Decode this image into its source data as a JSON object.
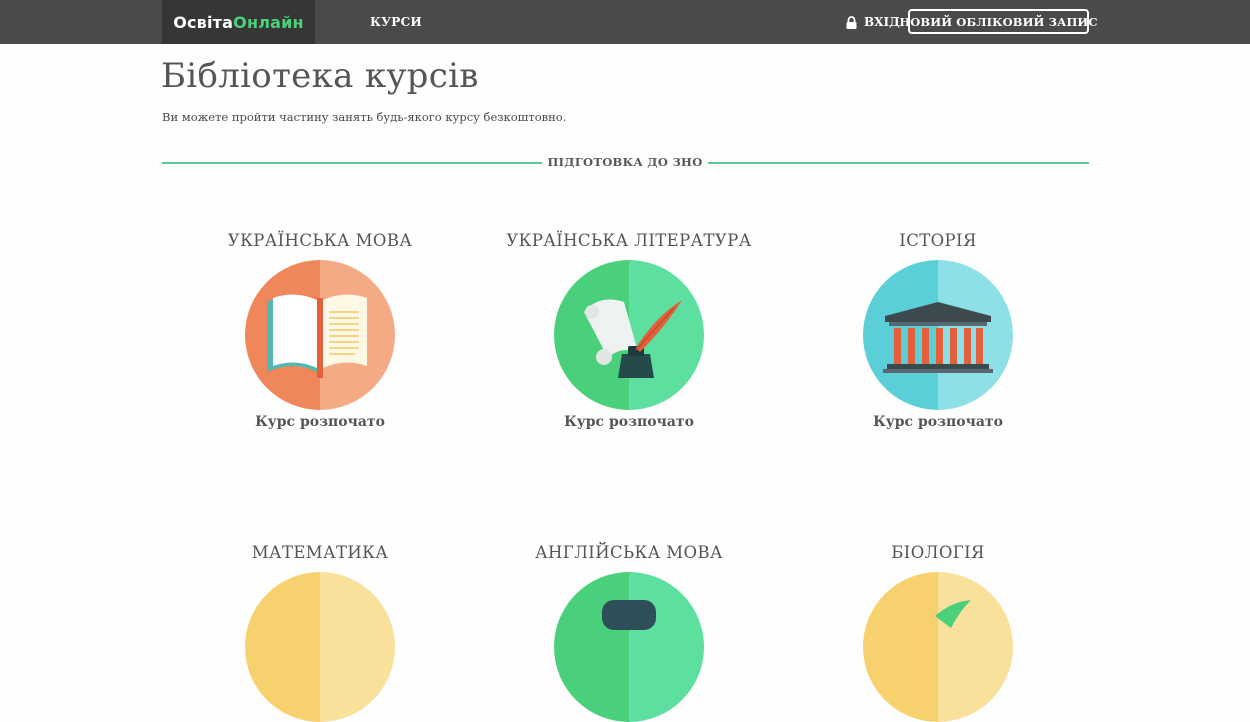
{
  "header": {
    "logo_part1": "Освіта",
    "logo_part2": "Онлайн",
    "nav_courses": "КУРСИ",
    "login": "ВХІД",
    "register": "НОВИЙ ОБЛІКОВИЙ ЗАПИС"
  },
  "page": {
    "title": "Бібліотека курсів",
    "subtitle": "Ви можете пройти частину занять будь-якого курсу безкоштовно."
  },
  "section": {
    "label": "ПІДГОТОВКА ДО ЗНО"
  },
  "courses": [
    {
      "title": "УКРАЇНСЬКА МОВА",
      "status": "Курс розпочато",
      "icon": "open-book-icon",
      "colors": [
        "#f0875a",
        "#f5aa86"
      ]
    },
    {
      "title": "УКРАЇНСЬКА ЛІТЕРАТУРА",
      "status": "Курс розпочато",
      "icon": "scroll-quill-icon",
      "colors": [
        "#4ad07a",
        "#5ddfa0"
      ]
    },
    {
      "title": "ІСТОРІЯ",
      "status": "Курс розпочато",
      "icon": "temple-icon",
      "colors": [
        "#5bcfd8",
        "#8de0e5"
      ]
    },
    {
      "title": "МАТЕМАТИКА",
      "status": "",
      "icon": "math-icon",
      "colors": [
        "#f7d16e",
        "#f9e19c"
      ]
    },
    {
      "title": "АНГЛІЙСЬКА МОВА",
      "status": "",
      "icon": "english-icon",
      "colors": [
        "#4ad07a",
        "#5ddfa0"
      ]
    },
    {
      "title": "БІОЛОГІЯ",
      "status": "",
      "icon": "leaf-icon",
      "colors": [
        "#f7d16e",
        "#f9e19c"
      ]
    }
  ],
  "colors": {
    "header_bg": "#4a4a4a",
    "logo_bg": "#363636",
    "logo_accent": "#4ad07a",
    "divider": "#5bc796"
  }
}
